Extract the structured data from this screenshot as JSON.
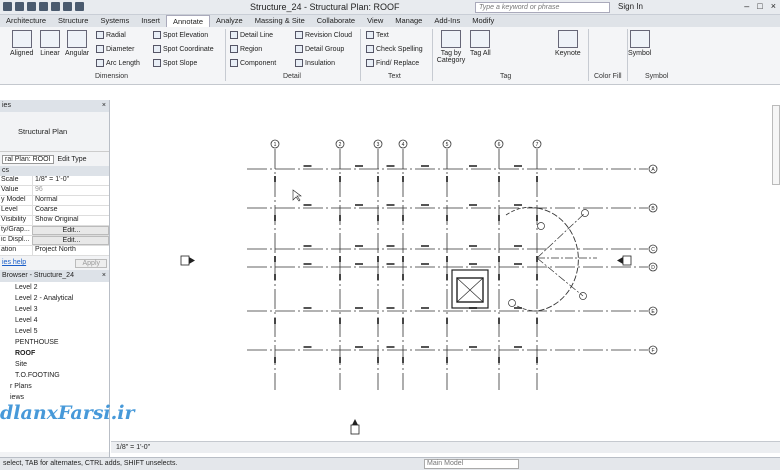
{
  "window": {
    "title": "Structure_24 - Structural Plan: ROOF",
    "search_placeholder": "Type a keyword or phrase",
    "signin": "Sign In"
  },
  "tabs": [
    "Architecture",
    "Structure",
    "Systems",
    "Insert",
    "Annotate",
    "Analyze",
    "Massing & Site",
    "Collaborate",
    "View",
    "Manage",
    "Add-Ins",
    "Modify"
  ],
  "active_tab": "Annotate",
  "ribbon": {
    "dimension": {
      "aligned": "Aligned",
      "linear": "Linear",
      "angular": "Angular",
      "radial": "Radial",
      "diameter": "Diameter",
      "arc_length": "Arc Length",
      "spot_elevation": "Spot Elevation",
      "spot_coordinate": "Spot Coordinate",
      "spot_slope": "Spot Slope",
      "label": "Dimension"
    },
    "detail": {
      "detail_line": "Detail Line",
      "region": "Region",
      "component": "Component",
      "revision_cloud": "Revision Cloud",
      "detail_group": "Detail Group",
      "insulation": "Insulation",
      "label": "Detail"
    },
    "text": {
      "text": "Text",
      "check_spelling": "Check Spelling",
      "find_replace": "Find/ Replace",
      "label": "Text"
    },
    "tag": {
      "tag_by_category": "Tag by Category",
      "tag_all": "Tag All",
      "keynote": "Keynote",
      "label": "Tag"
    },
    "color_fill": {
      "label": "Color Fill"
    },
    "symbol": {
      "symbol": "Symbol",
      "label": "Symbol"
    }
  },
  "properties": {
    "header": "ies",
    "type_name": "Structural Plan",
    "selector": "ral Plan: ROOI",
    "edit_type": "Edit Type",
    "section": "cs",
    "rows": [
      {
        "k": "Scale",
        "v": "1/8\" = 1'-0\""
      },
      {
        "k": "Value",
        "v": "96"
      },
      {
        "k": "y Model",
        "v": "Normal"
      },
      {
        "k": "Level",
        "v": "Coarse"
      },
      {
        "k": "Visibility",
        "v": "Show Original"
      },
      {
        "k": "ty/Grap...",
        "v": "Edit..."
      },
      {
        "k": "ic Displ...",
        "v": "Edit..."
      },
      {
        "k": "ation",
        "v": "Project North"
      }
    ],
    "help": "ies help",
    "apply": "Apply"
  },
  "browser": {
    "header": "Browser - Structure_24",
    "items": [
      "Level 2",
      "Level 2 - Analytical",
      "Level 3",
      "Level 4",
      "Level 5",
      "PENTHOUSE",
      "ROOF",
      "Site",
      "T.O.FOOTING",
      "r Plans",
      "iews"
    ]
  },
  "viewbar": {
    "scale": "1/8\" = 1'-0\""
  },
  "statusbar": {
    "hint": "select, TAB for alternates, CTRL adds, SHIFT unselects.",
    "model": "Main Model"
  },
  "watermark": "dlanxFarsi.ir",
  "drawing": {
    "grid_top": [
      "1",
      "2",
      "3",
      "4",
      "5",
      "6",
      "7"
    ],
    "grid_right": [
      "A",
      "B",
      "C",
      "D",
      "E",
      "F"
    ]
  }
}
